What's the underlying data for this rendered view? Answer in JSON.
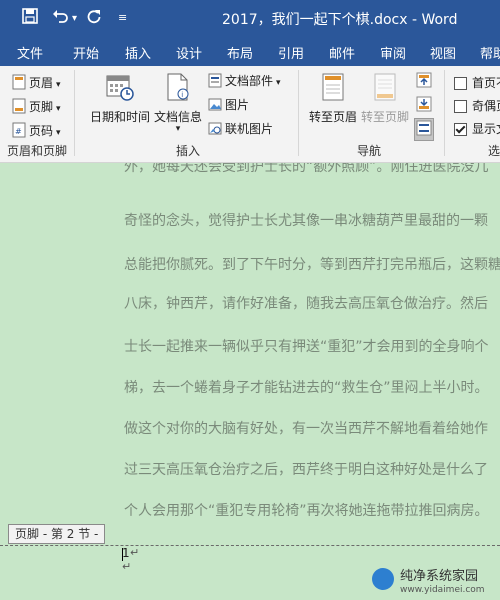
{
  "titlebar": {
    "title": "2017，我们一起下个棋.docx - Word",
    "save_icon": "save-icon",
    "undo_icon": "undo-icon",
    "redo_icon": "redo-icon",
    "customize_icon": "customize-qat-icon"
  },
  "tabs": [
    "文件",
    "开始",
    "插入",
    "设计",
    "布局",
    "引用",
    "邮件",
    "审阅",
    "视图",
    "帮助"
  ],
  "ribbon": {
    "header_footer": {
      "header": "页眉",
      "footer": "页脚",
      "page_number": "页码",
      "group_label": "页眉和页脚"
    },
    "insert": {
      "date_time": "日期和时间",
      "doc_info": "文档信息",
      "quick_parts": "文档部件",
      "pictures": "图片",
      "online_pictures": "联机图片",
      "group_label": "插入"
    },
    "navigation": {
      "goto_header": "转至页眉",
      "goto_footer": "转至页脚",
      "group_label": "导航"
    },
    "options": {
      "first_page": "首页不",
      "odd_even": "奇偶页",
      "show_doc": "显示文",
      "group_label": "选"
    }
  },
  "document": {
    "lines": [
      "外，她每天还会受到护士长的“额外照顾”。刚住进医院没几",
      "奇怪的念头，觉得护士长尤其像一串冰糖葫芦里最甜的一颗",
      "总能把你腻死。到了下午时分，等到西芹打完吊瓶后，这颗糖",
      "八床，钟西芹，请作好准备，随我去高压氧仓做治疗。然后",
      "士长一起推来一辆似乎只有押送“重犯”才会用到的全身响个",
      "梯，去一个蜷着身子才能钻进去的“救生仓”里闷上半小时。",
      "做这个对你的大脑有好处，有一次当西芹不解地看着给她作",
      "过三天高压氧仓治疗之后，西芹终于明白这种好处是什么了",
      "个人会用那个“重犯专用轮椅”再次将她连拖带拉推回病房。"
    ],
    "footer_label": "页脚 - 第 2 节 -",
    "page_number": "1",
    "para_mark": "↵"
  },
  "watermark": {
    "text": "纯净系统家园",
    "url": "www.yidaimei.com"
  }
}
